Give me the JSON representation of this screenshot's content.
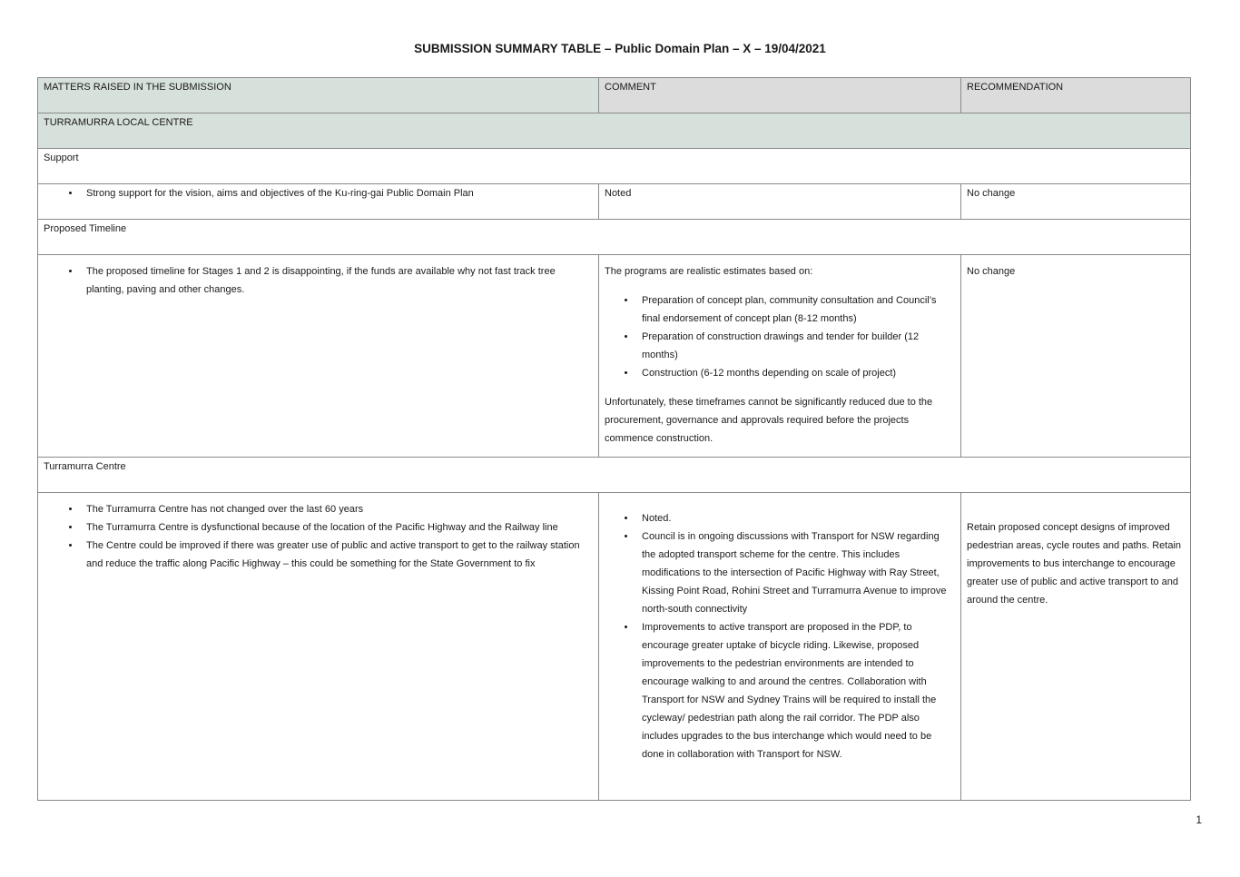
{
  "title": "SUBMISSION SUMMARY TABLE – Public Domain Plan – X – 19/04/2021",
  "headers": {
    "matters": "MATTERS RAISED IN THE SUBMISSION",
    "comment": "COMMENT",
    "recommendation": "RECOMMENDATION"
  },
  "centre": "TURRAMURRA LOCAL CENTRE",
  "sections": [
    {
      "heading": "Support",
      "matters": [
        "Strong support for the vision, aims and objectives of the Ku-ring-gai Public Domain Plan"
      ],
      "comment": "Noted",
      "recommendation": "No change"
    },
    {
      "heading": "Proposed Timeline",
      "matters": [
        "The proposed timeline for Stages 1 and 2 is disappointing, if the funds are available why not fast track tree planting, paving and other changes."
      ],
      "comment_intro": "The programs are realistic estimates based on:",
      "comment_points": [
        "Preparation of concept plan, community consultation and Council’s final endorsement of concept plan (8-12 months)",
        "Preparation of construction drawings and tender for builder (12 months)",
        "Construction (6-12 months depending on scale of project)"
      ],
      "comment_outro": "Unfortunately, these timeframes cannot be significantly reduced due to the procurement, governance and approvals required before the projects commence construction.",
      "recommendation": "No change"
    },
    {
      "heading": "Turramurra Centre",
      "matters": [
        "The Turramurra Centre has not changed over the last 60 years",
        "The Turramurra Centre is dysfunctional because of the location of the Pacific Highway and the Railway line",
        "The Centre could be improved if there was greater use of public and active transport to get to the railway station and reduce the traffic along Pacific Highway – this could be something for the State Government to fix"
      ],
      "comment_points": [
        "Noted.",
        "Council is in ongoing discussions with Transport for NSW regarding the adopted transport scheme for the centre. This includes modifications to the intersection of Pacific Highway with Ray Street, Kissing Point Road, Rohini Street and Turramurra Avenue to improve north-south connectivity",
        "Improvements to active transport are proposed in the PDP, to encourage greater uptake of bicycle riding. Likewise, proposed improvements to the pedestrian environments are intended to encourage walking to and around the centres. Collaboration with Transport for NSW and Sydney Trains will be required to install the cycleway/ pedestrian path along the rail corridor. The PDP also includes upgrades to the bus interchange which would need to be done in collaboration with Transport for NSW."
      ],
      "recommendation": "Retain proposed concept designs of improved pedestrian areas, cycle routes and paths. Retain improvements to bus interchange to encourage greater use of public and active transport to and around the centre."
    }
  ],
  "page_number": "1",
  "colors": {
    "header_green": "#d7e1dc",
    "header_grey": "#dcdcdc",
    "border": "#8a8a8a"
  }
}
